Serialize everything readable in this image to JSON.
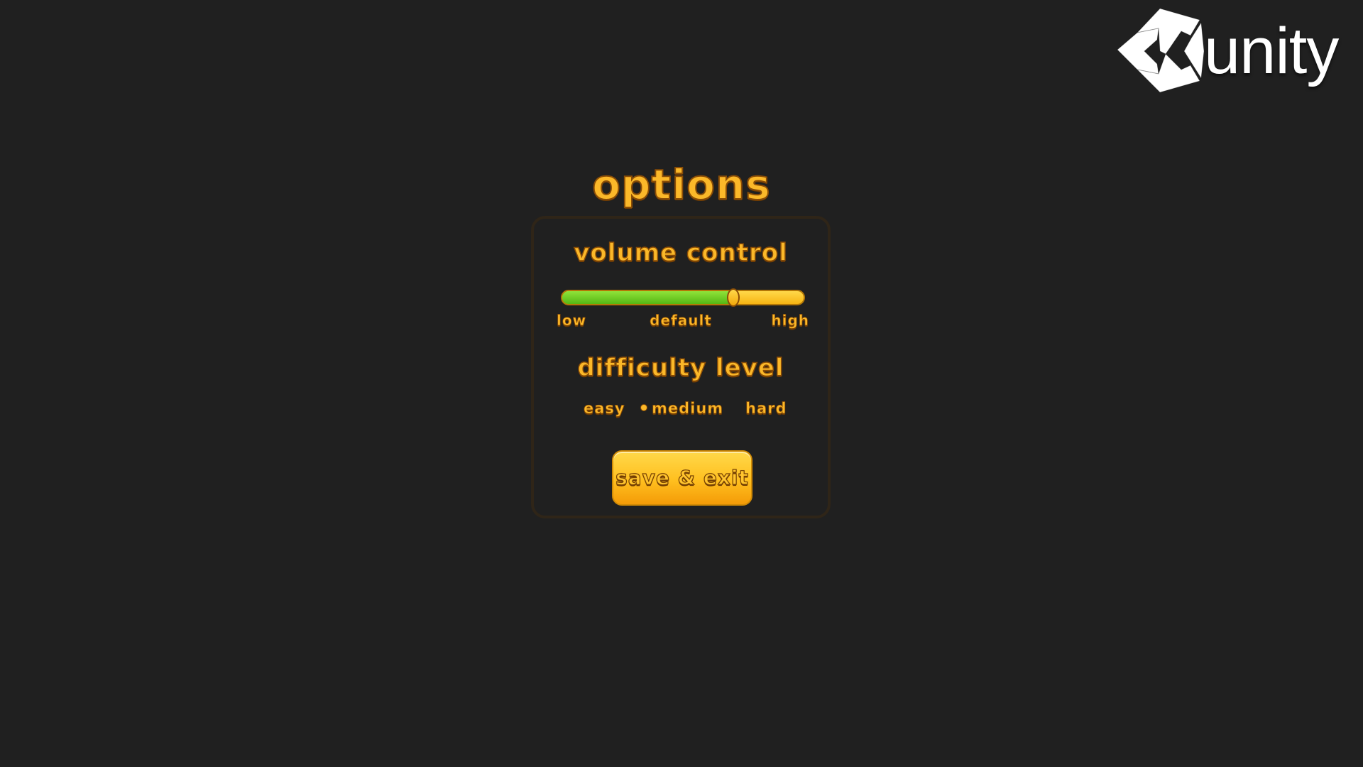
{
  "logo": {
    "text": "unity"
  },
  "title": "options",
  "volume": {
    "label": "volume control",
    "level": 0.71,
    "ticks": {
      "low": "low",
      "default": "default",
      "high": "high"
    }
  },
  "difficulty": {
    "label": "difficulty level",
    "options": [
      "easy",
      "medium",
      "hard"
    ],
    "selected": "medium"
  },
  "save_button": "save & exit",
  "colors": {
    "background": "#202020",
    "accent": "#fbb829",
    "slider_fill": "#6cc81f"
  },
  "icons": {
    "logo": "unity-logo-icon",
    "selected_marker": "radio-dot-icon"
  }
}
